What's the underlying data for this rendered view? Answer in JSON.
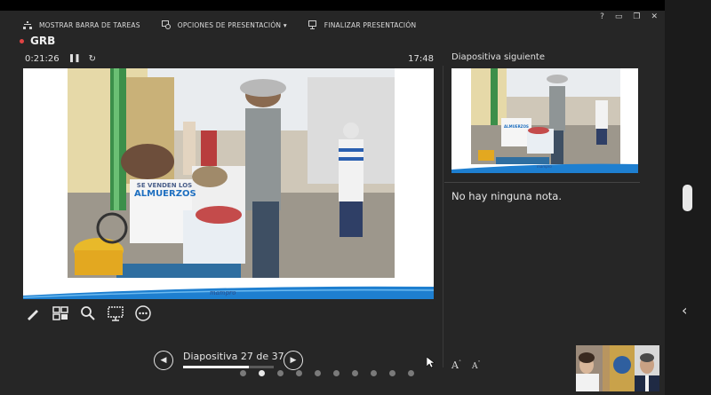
{
  "toolbar": {
    "taskbar_label": "MOSTRAR BARRA DE TAREAS",
    "options_label": "OPCIONES DE PRESENTACIÓN ▾",
    "end_label": "FINALIZAR PRESENTACIÓN"
  },
  "window_controls": {
    "help": "?",
    "minimize": "▭",
    "restore": "❐",
    "close": "✕"
  },
  "session_name": "GRB",
  "timer": {
    "elapsed": "0:21:26",
    "clock": "17:48"
  },
  "current_slide": {
    "sign_line1": "SE VENDEN LOS",
    "sign_line2": "ALMUERZOS",
    "logo_text": "mampro"
  },
  "tools": [
    "pen-icon",
    "grid-icon",
    "zoom-icon",
    "pointer-icon",
    "more-icon"
  ],
  "navigation": {
    "label": "Diapositiva 27 de 37",
    "current": 27,
    "total": 37
  },
  "dots": {
    "count": 10,
    "active_index": 1
  },
  "next_slide": {
    "title": "Diapositiva siguiente",
    "sign_text": "ALMUERZOS",
    "logo_text": "mampro"
  },
  "notes_text": "No hay ninguna nota.",
  "font_controls": {
    "increase": "A",
    "decrease": "A"
  },
  "side_panel": {
    "chevron": "‹"
  },
  "colors": {
    "accent_blue": "#1e7fd0",
    "background": "#262626",
    "record_dot": "#e04444"
  }
}
